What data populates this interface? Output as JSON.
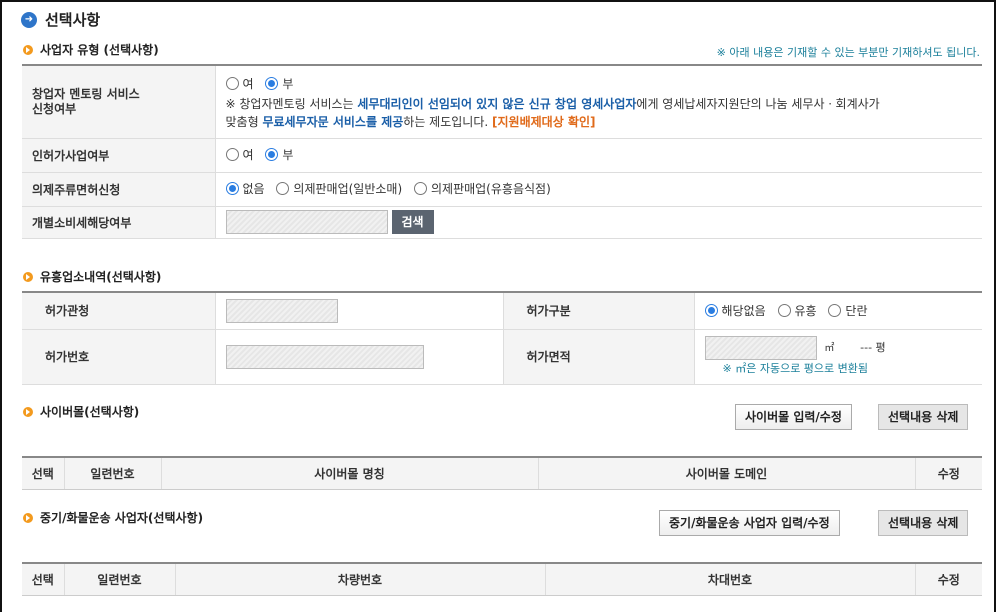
{
  "page_title": "선택사항",
  "business": {
    "section_title": "사업자 유형 (선택사항)",
    "note": "※ 아래 내용은 기재할 수 있는 부분만 기재하셔도 됩니다.",
    "mentoring_label": "창업자 멘토링 서비스\n신청여부",
    "yes": "여",
    "no": "부",
    "mentoring_note_a": "※ 창업자멘토링 서비스는 ",
    "mentoring_note_b": "세무대리인이 선임되어 있지 않은 신규 창업 영세사업자",
    "mentoring_note_c": "에게 영세납세자지원단의 나눔 세무사ㆍ회계사가",
    "mentoring_note_d": "맞춤형 ",
    "mentoring_note_e": "무료세무자문 서비스를 제공",
    "mentoring_note_f": "하는 제도입니다. ",
    "mentoring_note_g": "[지원배제대상 확인]",
    "license_label": "인허가사업여부",
    "liquor_label": "의제주류면허신청",
    "liquor_opt1": "없음",
    "liquor_opt2": "의제판매업(일반소매)",
    "liquor_opt3": "의제판매업(유흥음식점)",
    "excise_label": "개별소비세해당여부",
    "search_button": "검색"
  },
  "entertainment": {
    "section_title": "유흥업소내역(선택사항)",
    "authority_label": "허가관청",
    "type_label": "허가구분",
    "type_opt1": "해당없음",
    "type_opt2": "유흥",
    "type_opt3": "단란",
    "number_label": "허가번호",
    "area_label": "허가면적",
    "area_unit": "㎡",
    "pyeong_display": "--- 평",
    "area_note": "※ ㎡은 자동으로 평으로 변환됨"
  },
  "cybermall": {
    "section_title": "사이버몰(선택사항)",
    "input_button": "사이버몰 입력/수정",
    "delete_button": "선택내용 삭제",
    "columns": [
      "선택",
      "일련번호",
      "사이버몰 명칭",
      "사이버몰 도메인",
      "수정"
    ]
  },
  "transport": {
    "section_title": "중기/화물운송 사업자(선택사항)",
    "input_button": "중기/화물운송 사업자 입력/수정",
    "delete_button": "선택내용 삭제",
    "columns": [
      "선택",
      "일련번호",
      "차량번호",
      "차대번호",
      "수정"
    ]
  }
}
